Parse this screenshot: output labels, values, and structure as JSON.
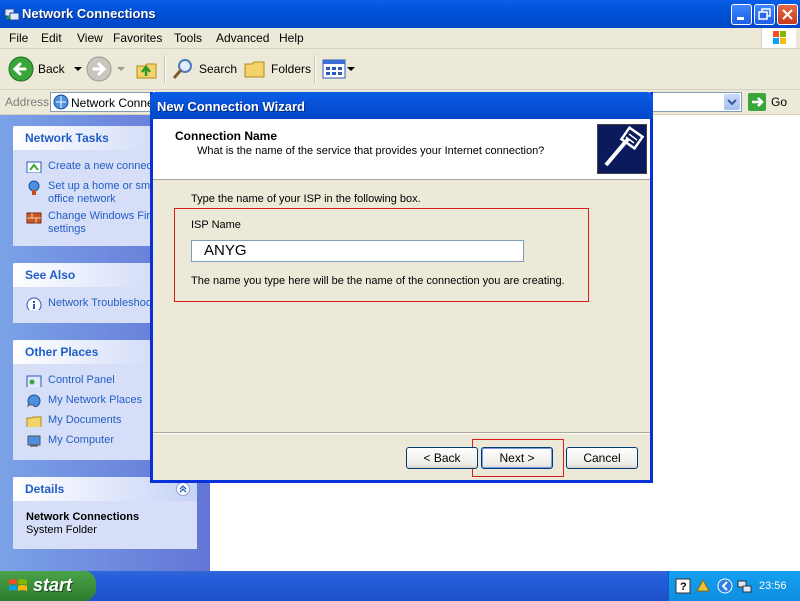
{
  "window": {
    "title": "Network Connections"
  },
  "menu": [
    "File",
    "Edit",
    "View",
    "Favorites",
    "Tools",
    "Advanced",
    "Help"
  ],
  "toolbar": {
    "back_label": "Back",
    "search_label": "Search",
    "folders_label": "Folders"
  },
  "address": {
    "label": "Address",
    "value": "Network Connec",
    "go_label": "Go"
  },
  "left_pane": {
    "network_tasks": {
      "title": "Network Tasks",
      "items": [
        "Create a new connec",
        "Set up a home or sma",
        "office network",
        "Change Windows Fire",
        "settings"
      ]
    },
    "see_also": {
      "title": "See Also",
      "items": [
        "Network Troubleshoo"
      ]
    },
    "other_places": {
      "title": "Other Places",
      "items": [
        "Control Panel",
        "My Network Places",
        "My Documents",
        "My Computer"
      ]
    },
    "details": {
      "title": "Details",
      "name": "Network Connections",
      "type": "System Folder"
    }
  },
  "dialog": {
    "title": "New Connection Wizard",
    "header_title": "Connection Name",
    "header_subtitle": "What is the name of the service that provides your Internet connection?",
    "instruction": "Type the name of your ISP in the following box.",
    "isp_label": "ISP Name",
    "isp_value": "ANYG",
    "hint": "The name you type here will be the name of the connection you are creating.",
    "buttons": {
      "back": "< Back",
      "next": "Next >",
      "cancel": "Cancel"
    }
  },
  "taskbar": {
    "start_label": "start",
    "clock": "23:56"
  },
  "colors": {
    "xp_blue": "#0a5ee8",
    "task_link": "#215dc6",
    "highlight_red": "#d91e1e",
    "start_green": "#3c8f3c"
  }
}
